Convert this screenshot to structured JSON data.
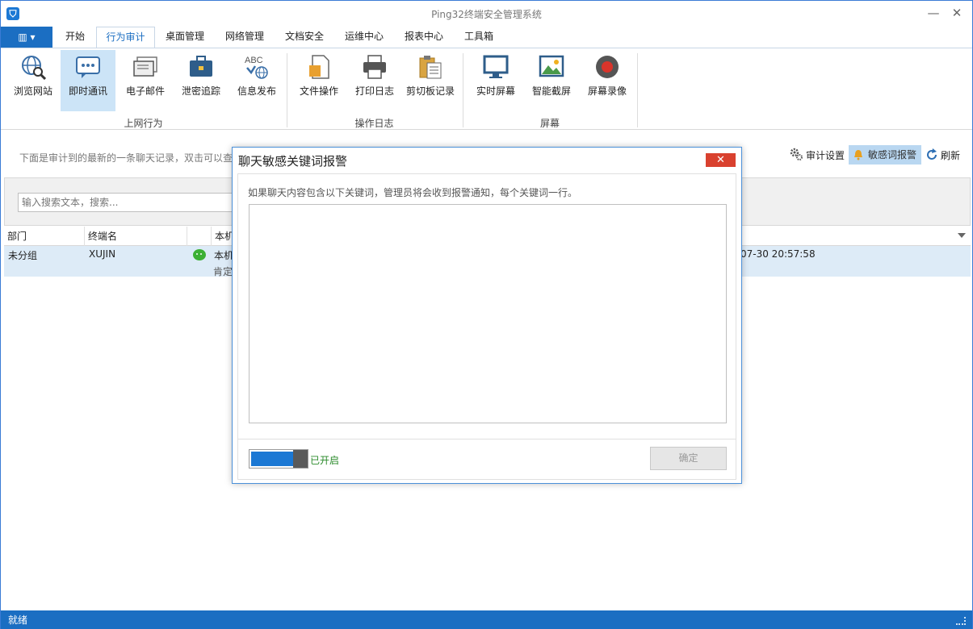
{
  "window": {
    "title": "Ping32终端安全管理系统",
    "minimize": "—",
    "close": "✕"
  },
  "tabs": {
    "file_menu": "▥ ▾",
    "items": [
      "开始",
      "行为审计",
      "桌面管理",
      "网络管理",
      "文档安全",
      "运维中心",
      "报表中心",
      "工具箱"
    ],
    "active": "行为审计"
  },
  "ribbon": {
    "groups": [
      {
        "label": "上网行为",
        "buttons": [
          "浏览网站",
          "即时通讯",
          "电子邮件",
          "泄密追踪",
          "信息发布"
        ]
      },
      {
        "label": "操作日志",
        "buttons": [
          "文件操作",
          "打印日志",
          "剪切板记录"
        ]
      },
      {
        "label": "屏幕",
        "buttons": [
          "实时屏幕",
          "智能截屏",
          "屏幕录像"
        ]
      }
    ],
    "active_button": "即时通讯",
    "abc_icon_text": "ABC"
  },
  "main": {
    "info_text": "下面是审计到的最新的一条聊天记录，双击可以查",
    "audit_settings": "审计设置",
    "keyword_alert": "敏感词报警",
    "refresh": "刷新",
    "search_placeholder": "输入搜索文本，搜索..."
  },
  "grid": {
    "columns": [
      "部门",
      "终端名",
      "",
      "本机"
    ],
    "row": {
      "dept": "未分组",
      "terminal": "XUJIN",
      "local_line1": "本机",
      "local_line2": "肯定",
      "time": "07-30 20:57:58"
    }
  },
  "statusbar": {
    "text": "就绪"
  },
  "dialog": {
    "title": "聊天敏感关键词报警",
    "close": "✕",
    "description": "如果聊天内容包含以下关键词，管理员将会收到报警通知，每个关键词一行。",
    "keywords_value": "",
    "toggle_label": "已开启",
    "toggle_on": true,
    "ok_button": "确定"
  }
}
